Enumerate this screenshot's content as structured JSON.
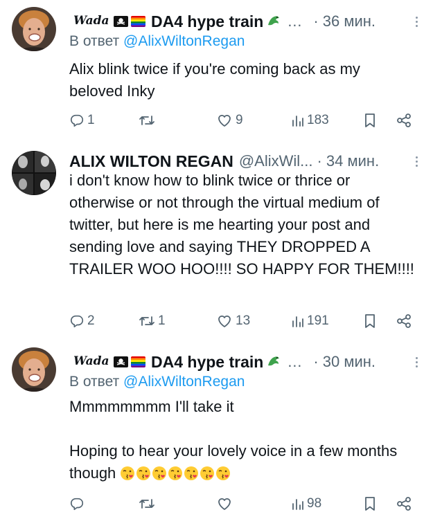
{
  "tweets": [
    {
      "author_name": "DA4 hype train",
      "author_script": "Wada",
      "time": "· 36 мин.",
      "reply_prefix": "В ответ",
      "reply_to": "@AlixWiltonRegan",
      "ellipsis": "…",
      "text_paragraphs": [
        "Alix blink twice if you're coming back as my beloved Inky"
      ],
      "stats": {
        "replies": "1",
        "retweets": "",
        "likes": "9",
        "views": "183"
      }
    },
    {
      "author_name": "ALIX WILTON REGAN",
      "handle": "@AlixWil...",
      "time": "· 34 мин.",
      "text_paragraphs": [
        "i don't know how to blink twice or thrice or otherwise or not through the virtual medium of twitter, but here is me hearting your post and sending love and saying THEY DROPPED A TRAILER WOO HOO!!!! SO HAPPY FOR THEM!!!!"
      ],
      "stats": {
        "replies": "2",
        "retweets": "1",
        "likes": "13",
        "views": "191"
      }
    },
    {
      "author_name": "DA4 hype train",
      "author_script": "Wada",
      "time": "· 30 мин.",
      "reply_prefix": "В ответ",
      "reply_to": "@AlixWiltonRegan",
      "ellipsis": "…",
      "text_paragraphs": [
        "Mmmmmmmm I'll take it",
        "Hoping to hear your lovely voice in a few months though"
      ],
      "emoji_count": 7,
      "stats": {
        "replies": "",
        "retweets": "",
        "likes": "",
        "views": "98"
      }
    }
  ],
  "icons": {
    "reply": "reply-icon",
    "retweet": "retweet-icon",
    "like": "heart-icon",
    "views": "views-icon",
    "bookmark": "bookmark-icon",
    "share": "share-icon",
    "more": "more-icon",
    "pirate_flag": "pirate-flag-icon",
    "rainbow_flag": "rainbow-flag-icon",
    "dragon": "dragon-emoji-icon",
    "kiss": "kissing-face-emoji-icon"
  },
  "colors": {
    "text": "#0f1419",
    "secondary": "#536471",
    "link": "#1d9bf0",
    "background": "#ffffff"
  }
}
